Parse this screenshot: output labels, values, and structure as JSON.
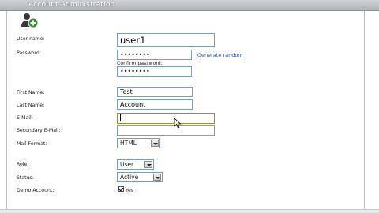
{
  "window": {
    "title": "Account Administration"
  },
  "form": {
    "username_label": "User name:",
    "username_value": "user1",
    "password_label": "Password:",
    "password_value": "••••••••",
    "generate_link": "Generate random",
    "confirm_label": "Confirm password:",
    "confirm_value": "••••••••",
    "first_name_label": "First Name:",
    "first_name_value": "Test",
    "last_name_label": "Last Name:",
    "last_name_value": "Account",
    "email_label": "E-Mail:",
    "email_value": "",
    "secondary_email_label": "Secondary E-Mail:",
    "secondary_email_value": "",
    "mail_format_label": "Mail Format:",
    "mail_format_value": "HTML",
    "role_label": "Role:",
    "role_value": "User",
    "status_label": "Status:",
    "status_value": "Active",
    "demo_label": "Demo Account:",
    "demo_checkbox_label": "Yes"
  },
  "icons": {
    "add_user": "add-user-icon",
    "cursor": "mouse-cursor-icon"
  },
  "colors": {
    "input_border": "#7f9db9",
    "link": "#1f4f9c",
    "add_badge": "#2e8b2e"
  }
}
